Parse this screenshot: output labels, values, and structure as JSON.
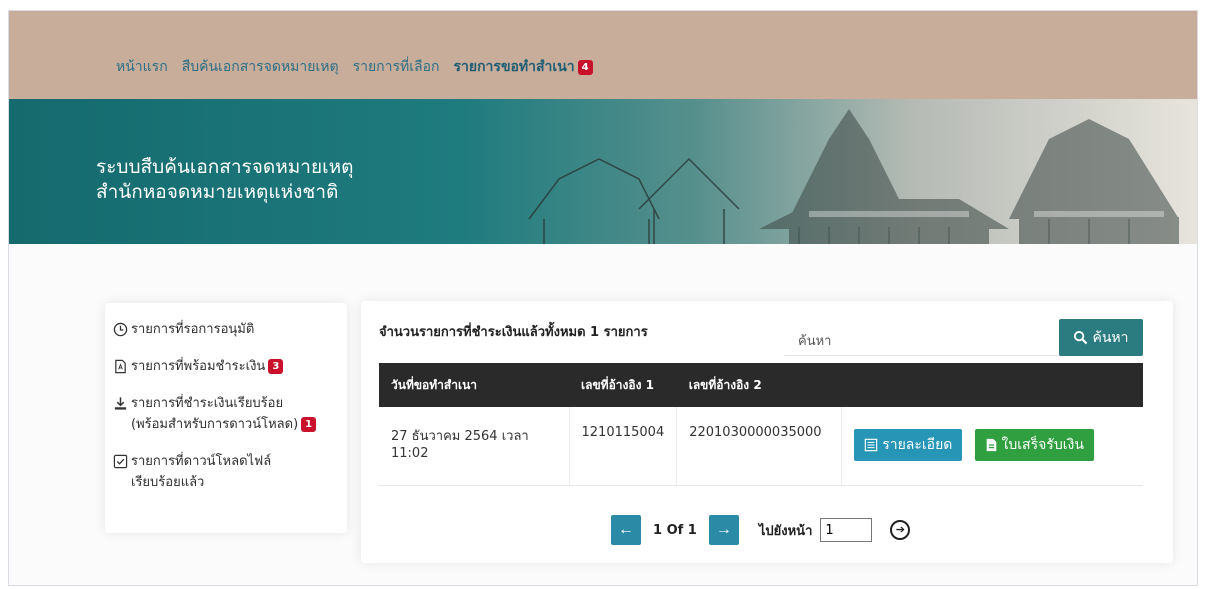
{
  "nav": {
    "items": [
      {
        "label": "หน้าแรก"
      },
      {
        "label": "สืบค้นเอกสารจดหมายเหตุ"
      },
      {
        "label": "รายการที่เลือก"
      },
      {
        "label": "รายการขอทำสำเนา",
        "badge": "4"
      }
    ]
  },
  "banner": {
    "line1": "ระบบสืบค้นเอกสารจดหมายเหตุ",
    "line2": "สำนักหอจดหมายเหตุแห่งชาติ"
  },
  "sidebar": {
    "items": [
      {
        "icon": "clock-icon",
        "label": "รายการที่รอการอนุมัติ"
      },
      {
        "icon": "pdf-file-icon",
        "label": "รายการที่พร้อมชำระเงิน",
        "badge": "3"
      },
      {
        "icon": "download-icon",
        "label": "รายการที่ชำระเงินเรียบร้อย",
        "label2": "(พร้อมสำหรับการดาวน์โหลด)",
        "badge": "1"
      },
      {
        "icon": "check-square-icon",
        "label": "รายการที่ดาวน์โหลดไฟล์",
        "label2": "เรียบร้อยแล้ว"
      }
    ]
  },
  "main": {
    "count_label": "จำนวนรายการที่ชำระเงินแล้วทั้งหมด 1 รายการ",
    "search": {
      "placeholder": "ค้นหา",
      "button_label": "ค้นหา"
    },
    "table": {
      "headers": [
        "วันที่ขอทำสำเนา",
        "เลขที่อ้างอิง 1",
        "เลขที่อ้างอิง 2",
        ""
      ],
      "rows": [
        {
          "date": "27 ธันวาคม 2564 เวลา 11:02",
          "ref1": "1210115004",
          "ref2": "2201030000035000",
          "detail_label": "รายละเอียด",
          "receipt_label": "ใบเสร็จรับเงิน"
        }
      ]
    },
    "pagination": {
      "page_info": "1 Of 1",
      "goto_label": "ไปยังหน้า",
      "goto_value": "1"
    }
  },
  "colors": {
    "nav_bg": "#c8ad9a",
    "nav_link": "#2d6f86",
    "banner_teal": "#156a6e",
    "badge": "#c9112c",
    "search_button": "#2b7c80",
    "detail_button": "#2795b6",
    "receipt_button": "#2f9f3f",
    "table_header": "#2a2a2a"
  }
}
